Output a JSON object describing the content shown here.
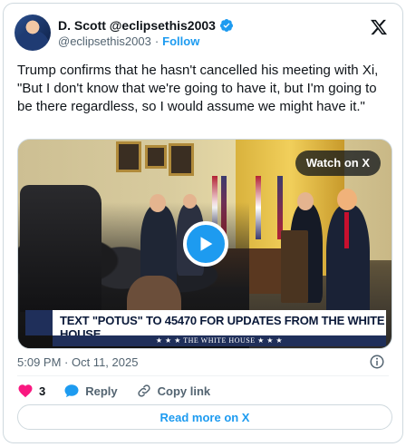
{
  "author": {
    "display_name": "D. Scott @eclipsethis2003",
    "handle": "@eclipsethis2003",
    "separator": "·",
    "follow_label": "Follow"
  },
  "tweet": {
    "text": "Trump confirms that he hasn't cancelled his meeting with Xi, \"But I don't know that we're going to have it, but I'm going to be there regardless, so I would assume we might have it.\"",
    "timestamp": "5:09 PM · Oct 11, 2025"
  },
  "media": {
    "watch_on_label": "Watch on X",
    "chyron_text": "TEXT \"POTUS\" TO 45470 FOR UPDATES FROM THE WHITE HOUSE",
    "chyron_sub": "★ ★ ★  THE WHITE HOUSE  ★ ★ ★"
  },
  "actions": {
    "like_count": "3",
    "reply_label": "Reply",
    "copy_link_label": "Copy link"
  },
  "read_more_label": "Read more on X",
  "colors": {
    "accent": "#1d9bf0",
    "like": "#f91880",
    "muted": "#536471",
    "border": "#cfd9de"
  },
  "icons": {
    "verified": "verified-badge-icon",
    "brand": "x-logo-icon",
    "play": "play-icon",
    "info": "info-icon",
    "like": "heart-icon",
    "reply": "reply-bubble-icon",
    "copy": "link-icon"
  }
}
